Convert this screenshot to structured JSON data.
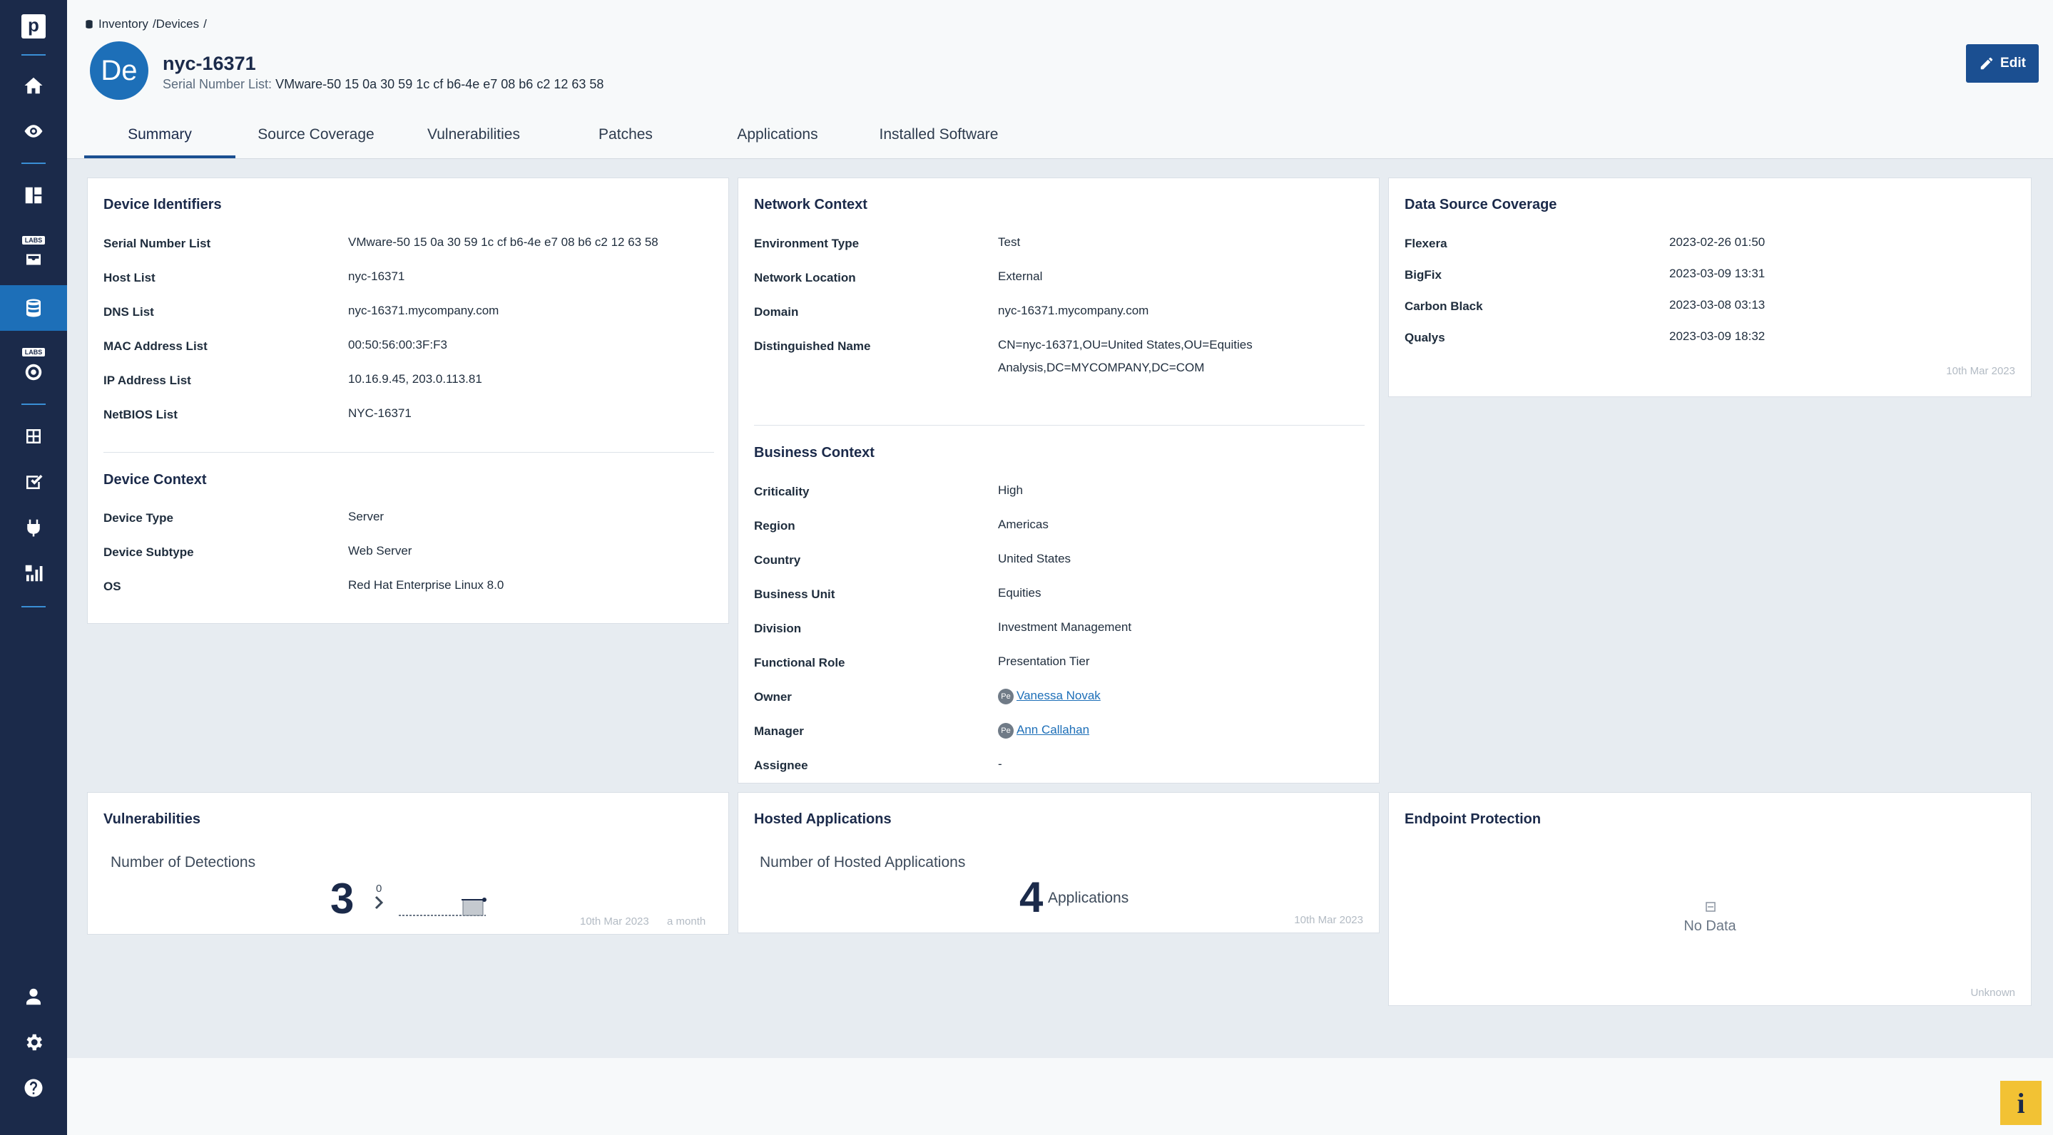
{
  "sidebar": {
    "logo": "p",
    "labs": [
      "LABS",
      "LABS"
    ]
  },
  "breadcrumb": {
    "root": "Inventory",
    "path": "/Devices",
    "sep": "/"
  },
  "device": {
    "avatar": "De",
    "title": "nyc-16371",
    "serial_label": "Serial Number List:",
    "serial_value": "VMware-50 15 0a 30 59 1c cf b6-4e e7 08 b6 c2 12 63 58"
  },
  "edit_label": "Edit",
  "tabs": [
    "Summary",
    "Source Coverage",
    "Vulnerabilities",
    "Patches",
    "Applications",
    "Installed Software"
  ],
  "device_identifiers": {
    "title": "Device Identifiers",
    "rows": [
      {
        "label": "Serial Number List",
        "value": "VMware-50 15 0a 30 59 1c cf b6-4e e7 08 b6 c2 12 63 58"
      },
      {
        "label": "Host List",
        "value": "nyc-16371"
      },
      {
        "label": "DNS List",
        "value": "nyc-16371.mycompany.com"
      },
      {
        "label": "MAC Address List",
        "value": "00:50:56:00:3F:F3"
      },
      {
        "label": "IP Address List",
        "value": "10.16.9.45, 203.0.113.81"
      },
      {
        "label": "NetBIOS List",
        "value": "NYC-16371"
      }
    ]
  },
  "device_context": {
    "title": "Device Context",
    "rows": [
      {
        "label": "Device Type",
        "value": "Server"
      },
      {
        "label": "Device Subtype",
        "value": "Web Server"
      },
      {
        "label": "OS",
        "value": "Red Hat Enterprise Linux 8.0"
      }
    ]
  },
  "network_context": {
    "title": "Network Context",
    "rows": [
      {
        "label": "Environment Type",
        "value": "Test"
      },
      {
        "label": "Network Location",
        "value": "External"
      },
      {
        "label": "Domain",
        "value": "nyc-16371.mycompany.com"
      },
      {
        "label": "Distinguished Name",
        "value": "CN=nyc-16371,OU=United States,OU=Equities",
        "value2": "Analysis,DC=MYCOMPANY,DC=COM"
      }
    ]
  },
  "business_context": {
    "title": "Business Context",
    "rows": [
      {
        "label": "Criticality",
        "value": "High"
      },
      {
        "label": "Region",
        "value": "Americas"
      },
      {
        "label": "Country",
        "value": "United States"
      },
      {
        "label": "Business Unit",
        "value": "Equities"
      },
      {
        "label": "Division",
        "value": "Investment Management"
      },
      {
        "label": "Functional Role",
        "value": "Presentation Tier"
      },
      {
        "label": "Owner",
        "value": "Vanessa Novak",
        "chip": "Pe"
      },
      {
        "label": "Manager",
        "value": "Ann Callahan",
        "chip": "Pe"
      },
      {
        "label": "Assignee",
        "value": "-"
      }
    ]
  },
  "data_source_coverage": {
    "title": "Data Source Coverage",
    "rows": [
      {
        "label": "Flexera",
        "value": "2023-02-26 01:50"
      },
      {
        "label": "BigFix",
        "value": "2023-03-09 13:31"
      },
      {
        "label": "Carbon Black",
        "value": "2023-03-08 03:13"
      },
      {
        "label": "Qualys",
        "value": "2023-03-09 18:32"
      }
    ],
    "footer_date": "10th Mar 2023"
  },
  "vulnerabilities": {
    "title": "Vulnerabilities",
    "metric_label": "Number of Detections",
    "value": "3",
    "delta": "0",
    "footer_date": "10th Mar 2023",
    "footer_ago": "a month"
  },
  "hosted_applications": {
    "title": "Hosted Applications",
    "metric_label": "Number of Hosted Applications",
    "value": "4",
    "unit": "Applications",
    "footer_date": "10th Mar 2023"
  },
  "endpoint_protection": {
    "title": "Endpoint Protection",
    "empty_text": "No Data",
    "footer": "Unknown"
  },
  "help_label": "i"
}
